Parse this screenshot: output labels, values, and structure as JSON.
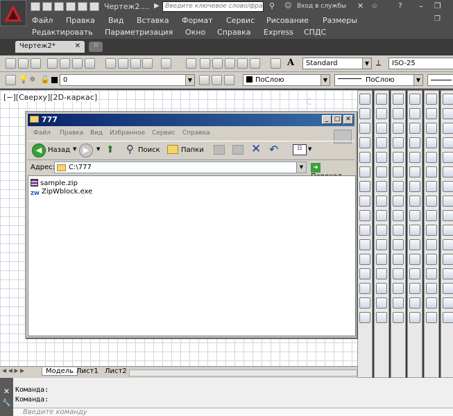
{
  "app": {
    "doc_title": "Чертеж2....",
    "search_placeholder": "Введите ключевое слово/фразу",
    "signin": "Вход в службы",
    "menu_row1": [
      "Файл",
      "Правка",
      "Вид",
      "Вставка",
      "Формат",
      "Сервис",
      "Рисование",
      "Размеры"
    ],
    "menu_row2": [
      "Редактировать",
      "Параметризация",
      "Окно",
      "Справка",
      "Express",
      "СПДС"
    ],
    "doc_tab": "Чертеж2*"
  },
  "toolbars": {
    "text_style": "Standard",
    "dim_style": "ISO-25",
    "layer": "0",
    "color": "ПоСлою",
    "linetype": "ПоСлою"
  },
  "viewport": {
    "label": "[−][Сверху][2D-каркас]"
  },
  "explorer": {
    "title": "777",
    "menu": [
      "Файл",
      "Правка",
      "Вид",
      "Избранное",
      "Сервис",
      "Справка"
    ],
    "back_label": "Назад",
    "search_label": "Поиск",
    "folders_label": "Папки",
    "address_label": "Адрес:",
    "address_value": "C:\\777",
    "go_label": "Переход",
    "files": [
      {
        "name": "sample.zip",
        "icon": "zip-archive-icon"
      },
      {
        "name": "ZipWblock.exe",
        "icon": "zw-exe-icon"
      }
    ]
  },
  "layout_tabs": [
    "Модель",
    "Лист1",
    "Лист2"
  ],
  "command": {
    "lines": [
      "Команда:",
      "Команда:"
    ],
    "input_placeholder": "Введите команду"
  },
  "colors": {
    "accent_title": "#0a246a",
    "chrome_dark": "#4d4d4d",
    "toolbar_grey": "#d4d0c8"
  }
}
